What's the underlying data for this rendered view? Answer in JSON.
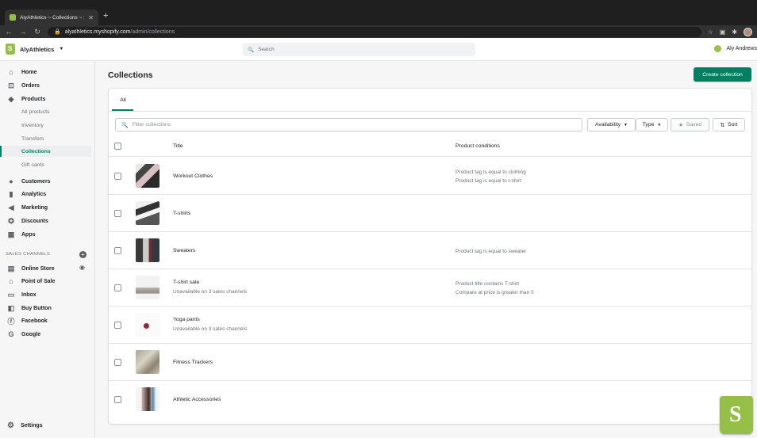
{
  "browser": {
    "tab_title": "AlyAthletics ~ Collections ~ Sh",
    "url_host": "alyathletics.myshopify.com",
    "url_path": "/admin/collections"
  },
  "topbar": {
    "store_name": "AlyAthletics",
    "search_placeholder": "Search",
    "user_name": "Aly Andrews"
  },
  "sidebar": {
    "items": [
      {
        "label": "Home",
        "icon": "home-icon"
      },
      {
        "label": "Orders",
        "icon": "orders-icon"
      },
      {
        "label": "Products",
        "icon": "tag-icon"
      },
      {
        "label": "Customers",
        "icon": "person-icon"
      },
      {
        "label": "Analytics",
        "icon": "bar-chart-icon"
      },
      {
        "label": "Marketing",
        "icon": "megaphone-icon"
      },
      {
        "label": "Discounts",
        "icon": "discount-icon"
      },
      {
        "label": "Apps",
        "icon": "apps-icon"
      }
    ],
    "product_subitems": [
      "All products",
      "Inventory",
      "Transfers",
      "Collections",
      "Gift cards"
    ],
    "sales_channels_label": "SALES CHANNELS",
    "channels": [
      {
        "label": "Online Store",
        "icon": "store-icon"
      },
      {
        "label": "Point of Sale",
        "icon": "pos-icon"
      },
      {
        "label": "Inbox",
        "icon": "inbox-icon"
      },
      {
        "label": "Buy Button",
        "icon": "buy-button-icon"
      },
      {
        "label": "Facebook",
        "icon": "facebook-icon"
      },
      {
        "label": "Google",
        "icon": "google-icon"
      }
    ],
    "settings_label": "Settings"
  },
  "page": {
    "title": "Collections",
    "create_button": "Create collection",
    "tab_all": "All",
    "filter_placeholder": "Filter collections",
    "availability_label": "Availability",
    "type_label": "Type",
    "saved_label": "Saved",
    "sort_label": "Sort",
    "col_title": "Title",
    "col_conditions": "Product conditions"
  },
  "collections": [
    {
      "title": "Workout Clothes",
      "sub": "",
      "conditions": [
        "Product tag is equal to clothing",
        "Product tag is equal to t-shirt"
      ]
    },
    {
      "title": "T-shirts",
      "sub": "",
      "conditions": []
    },
    {
      "title": "Sweaters",
      "sub": "",
      "conditions": [
        "Product tag is equal to sweater"
      ]
    },
    {
      "title": "T-shirt sale",
      "sub": "Unavailable on 3 sales channels",
      "conditions": [
        "Product title contains T-shirt",
        "Compare at price is greater than 0"
      ]
    },
    {
      "title": "Yoga pants",
      "sub": "Unavailable on 3 sales channels",
      "conditions": []
    },
    {
      "title": "Fitness Trackers",
      "sub": "",
      "conditions": []
    },
    {
      "title": "Athletic Accessories",
      "sub": "",
      "conditions": []
    }
  ],
  "colors": {
    "accent": "#008060",
    "brand": "#95bf47"
  }
}
